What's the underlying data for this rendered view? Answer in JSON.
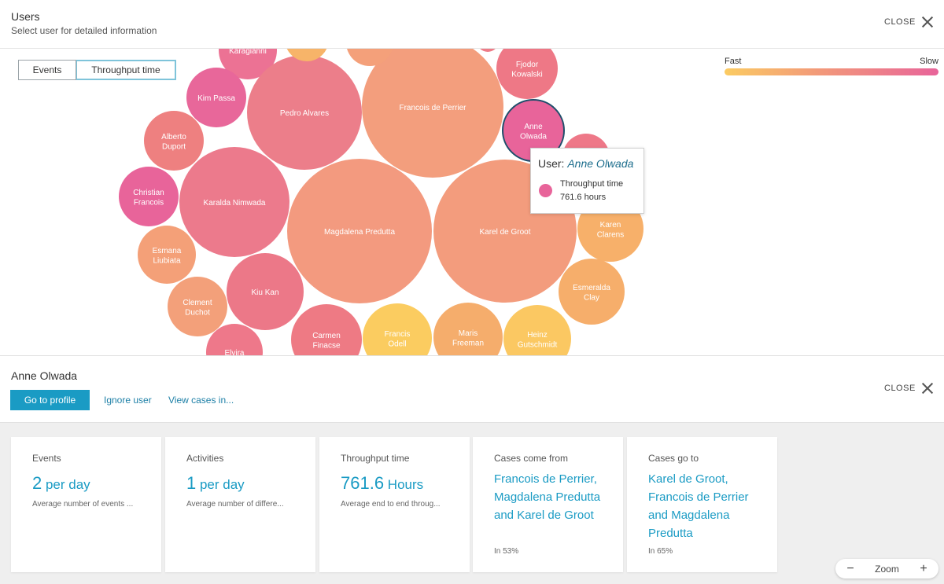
{
  "header": {
    "title": "Users",
    "subtitle": "Select user for detailed information",
    "close_label": "CLOSE"
  },
  "toggle": {
    "options": [
      "Events",
      "Throughput time"
    ],
    "selected": "Throughput time"
  },
  "legend": {
    "fast_label": "Fast",
    "slow_label": "Slow"
  },
  "bubbles": [
    {
      "name": "Karagianni",
      "label": [
        "Karagianni"
      ],
      "color": "#ec7294"
    },
    {
      "name": "Kim Passa",
      "label": [
        "Kim Passa"
      ],
      "color": "#e8679a"
    },
    {
      "name": "Alberto Duport",
      "label": [
        "Alberto",
        "Duport"
      ],
      "color": "#ee8080"
    },
    {
      "name": "Christian Francois",
      "label": [
        "Christian",
        "Francois"
      ],
      "color": "#e8649a"
    },
    {
      "name": "Esmana Liubiata",
      "label": [
        "Esmana",
        "Liubiata"
      ],
      "color": "#f4a078"
    },
    {
      "name": "Clement Duchot",
      "label": [
        "Clement",
        "Duchot"
      ],
      "color": "#f3a07a"
    },
    {
      "name": "Elvira",
      "label": [
        "Elvira"
      ],
      "color": "#ee788a"
    },
    {
      "name": "Pedro Alvares",
      "label": [
        "Pedro Alvares"
      ],
      "color": "#ec7e8a"
    },
    {
      "name": "Karalda Nimwada",
      "label": [
        "Karalda Nimwada"
      ],
      "color": "#ec7a8c"
    },
    {
      "name": "Kiu Kan",
      "label": [
        "Kiu Kan"
      ],
      "color": "#ec7888"
    },
    {
      "name": "Carmen Finacse",
      "label": [
        "Carmen",
        "Finacse"
      ],
      "color": "#ee7a84"
    },
    {
      "name": "Francois de Perrier",
      "label": [
        "Francois de Perrier"
      ],
      "color": "#f39e7d"
    },
    {
      "name": "Magdalena Predutta",
      "label": [
        "Magdalena Predutta"
      ],
      "color": "#f39a7f"
    },
    {
      "name": "Karel de Groot",
      "label": [
        "Karel de Groot"
      ],
      "color": "#f39c7d"
    },
    {
      "name": "Francis Odell",
      "label": [
        "Francis",
        "Odell"
      ],
      "color": "#fbcc60"
    },
    {
      "name": "Maris Freeman",
      "label": [
        "Maris",
        "Freeman"
      ],
      "color": "#f5ad6c"
    },
    {
      "name": "Heinz Gutschmidt",
      "label": [
        "Heinz",
        "Gutschmidt"
      ],
      "color": "#fbc862"
    },
    {
      "name": "Fjodor Kowalski",
      "label": [
        "Fjodor",
        "Kowalski"
      ],
      "color": "#ee7886"
    },
    {
      "name": "Anne Olwada",
      "label": [
        "Anne",
        "Olwada"
      ],
      "color": "#e8649a",
      "selected": true
    },
    {
      "name": "",
      "label": [],
      "color": "#ee7888"
    },
    {
      "name": "Karen Clarens",
      "label": [
        "Karen",
        "Clarens"
      ],
      "color": "#f7b06a"
    },
    {
      "name": "Esmeralda Clay",
      "label": [
        "Esmeralda",
        "Clay"
      ],
      "color": "#f6ae6b"
    },
    {
      "name": "",
      "label": [],
      "color": "#f7b469"
    },
    {
      "name": "",
      "label": [],
      "color": "#f4a07a"
    },
    {
      "name": "",
      "label": [],
      "color": "#ee7c88"
    }
  ],
  "tooltip": {
    "prefix": "User: ",
    "user": "Anne Olwada",
    "metric_label": "Throughput time",
    "metric_value": "761.6 hours",
    "color": "#e8649a"
  },
  "detail": {
    "name": "Anne Olwada",
    "go_to_profile": "Go to profile",
    "ignore_user": "Ignore user",
    "view_cases": "View cases in...",
    "close_label": "CLOSE"
  },
  "cards": [
    {
      "label": "Events",
      "number": "2",
      "unit": " per day",
      "sub": "Average number of events ..."
    },
    {
      "label": "Activities",
      "number": "1",
      "unit": " per day",
      "sub": "Average number of differe..."
    },
    {
      "label": "Throughput time",
      "number": "761.6",
      "unit": " Hours",
      "sub": "Average end to end throug..."
    },
    {
      "label": "Cases come from",
      "names": "Francois de Perrier, Magdalena Predutta and Karel de Groot",
      "pct": "In 53%"
    },
    {
      "label": "Cases go to",
      "names": "Karel de Groot, Francois de Perrier and Magdalena Predutta",
      "pct": "In 65%"
    }
  ],
  "zoom": {
    "label": "Zoom",
    "minus": "−",
    "plus": "+"
  }
}
